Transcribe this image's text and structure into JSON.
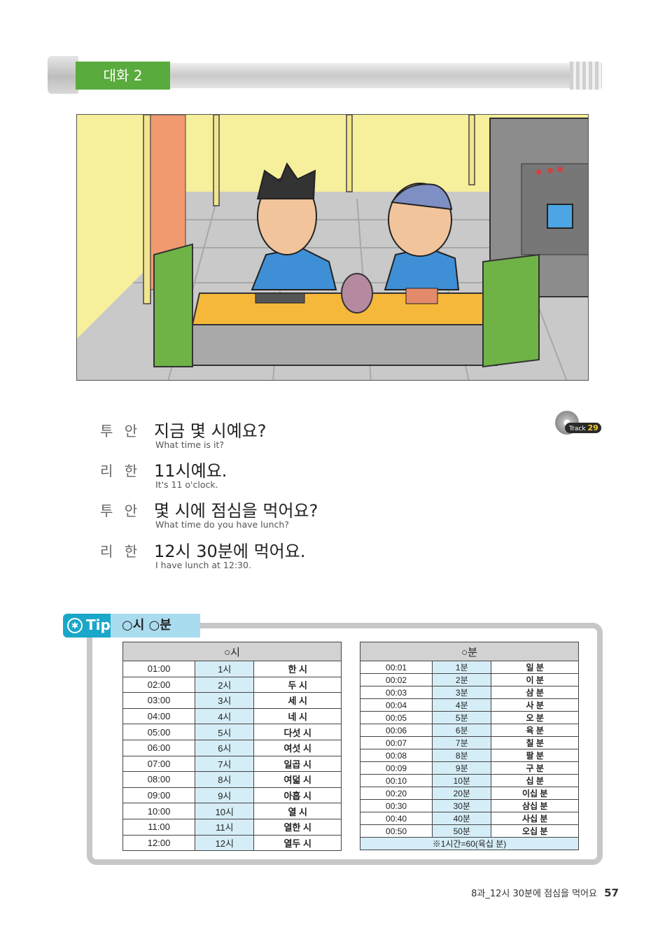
{
  "header": {
    "section_label": "대화 2"
  },
  "track": {
    "word": "Track",
    "number": "29"
  },
  "dialogue": [
    {
      "speaker": "투 안",
      "korean": "지금 몇 시예요?",
      "english": "What time is it?"
    },
    {
      "speaker": "리 한",
      "korean": "11시예요.",
      "english": "It's 11 o'clock."
    },
    {
      "speaker": "투 안",
      "korean": "몇 시에 점심을 먹어요?",
      "english": "What time do you have lunch?"
    },
    {
      "speaker": "리 한",
      "korean": "12시 30분에 먹어요.",
      "english": "I have lunch at 12:30."
    }
  ],
  "tip": {
    "badge": "Tip",
    "title": "○시 ○분",
    "hours_table": {
      "header": "○시",
      "rows": [
        [
          "01:00",
          "1시",
          "한 시"
        ],
        [
          "02:00",
          "2시",
          "두 시"
        ],
        [
          "03:00",
          "3시",
          "세 시"
        ],
        [
          "04:00",
          "4시",
          "네 시"
        ],
        [
          "05:00",
          "5시",
          "다섯 시"
        ],
        [
          "06:00",
          "6시",
          "여섯 시"
        ],
        [
          "07:00",
          "7시",
          "일곱 시"
        ],
        [
          "08:00",
          "8시",
          "여덟 시"
        ],
        [
          "09:00",
          "9시",
          "아홉 시"
        ],
        [
          "10:00",
          "10시",
          "열 시"
        ],
        [
          "11:00",
          "11시",
          "열한 시"
        ],
        [
          "12:00",
          "12시",
          "열두 시"
        ]
      ]
    },
    "minutes_table": {
      "header": "○분",
      "rows": [
        [
          "00:01",
          "1분",
          "일 분"
        ],
        [
          "00:02",
          "2분",
          "이 분"
        ],
        [
          "00:03",
          "3분",
          "삼 분"
        ],
        [
          "00:04",
          "4분",
          "사 분"
        ],
        [
          "00:05",
          "5분",
          "오 분"
        ],
        [
          "00:06",
          "6분",
          "육 분"
        ],
        [
          "00:07",
          "7분",
          "칠 분"
        ],
        [
          "00:08",
          "8분",
          "팔 분"
        ],
        [
          "00:09",
          "9분",
          "구 분"
        ],
        [
          "00:10",
          "10분",
          "십 분"
        ],
        [
          "00:20",
          "20분",
          "이십 분"
        ],
        [
          "00:30",
          "30분",
          "삼십 분"
        ],
        [
          "00:40",
          "40분",
          "사십 분"
        ],
        [
          "00:50",
          "50분",
          "오십 분"
        ]
      ],
      "note": "※1시간=60(육십 분)"
    }
  },
  "footer": {
    "chapter": "8과_12시 30분에 점심을 먹어요",
    "page": "57"
  },
  "colors": {
    "section_green": "#58ab3c",
    "tip_blue": "#1aa7c9",
    "tip_light": "#aadcef",
    "table_accent": "#d5edf7"
  }
}
